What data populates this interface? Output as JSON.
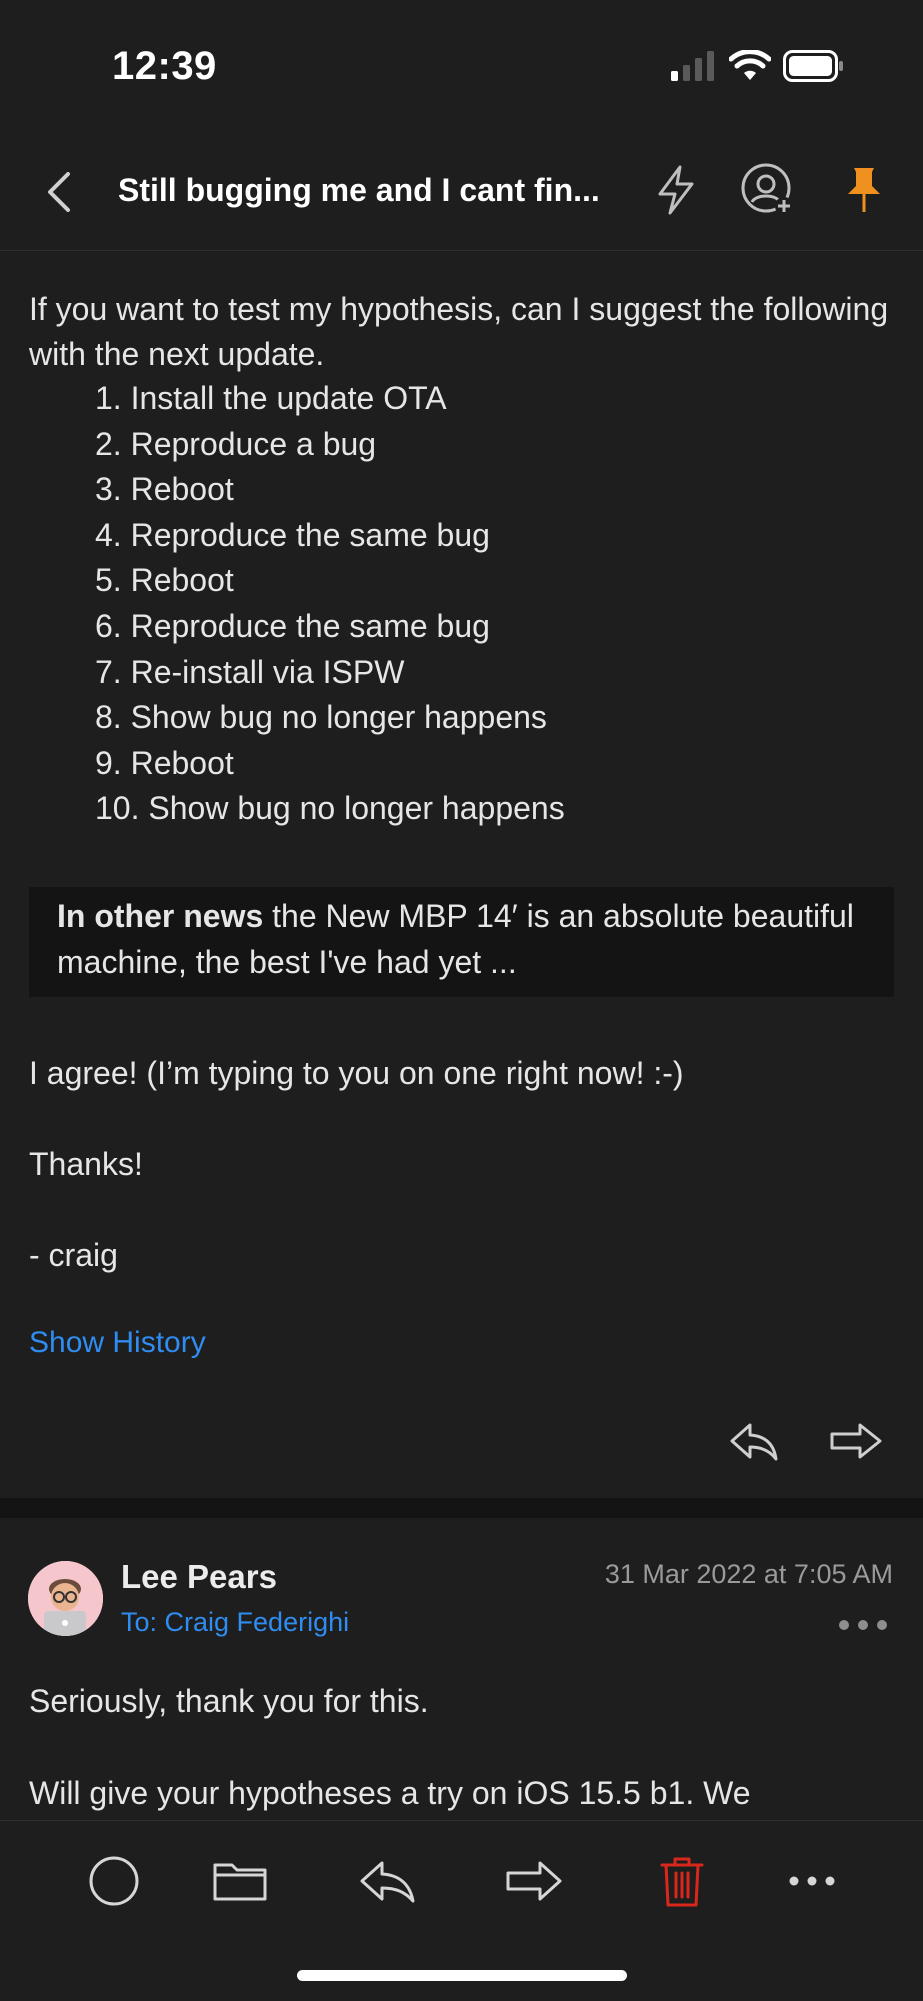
{
  "status": {
    "time": "12:39"
  },
  "header": {
    "subject": "Still bugging me and I cant fin..."
  },
  "message1": {
    "intro": "If you want to test my hypothesis, can I suggest the following with the next update.",
    "steps": [
      "1. Install the update OTA",
      "2. Reproduce a bug",
      "3. Reboot",
      "4. Reproduce the same bug",
      "5. Reboot",
      "6. Reproduce the same bug",
      "7. Re-install via ISPW",
      "8. Show bug no longer happens",
      "9. Reboot",
      "10. Show bug no longer happens"
    ],
    "quote_bold": "In other news",
    "quote_rest": " the New MBP 14′ is an absolute beautiful machine, the best I've had yet ...",
    "reply_line": "I agree!  (I’m typing to you on one right now! :-)",
    "thanks": "Thanks!",
    "signature": "- craig",
    "show_history": "Show History"
  },
  "message2": {
    "sender": "Lee Pears",
    "to": "To: Craig Federighi",
    "date": "31 Mar 2022 at 7:05 AM",
    "line1": "Seriously, thank you for this.",
    "line2": "Will give your hypotheses a try on iOS 15.5 b1. We"
  },
  "colors": {
    "background": "#1e1e1e",
    "link": "#2f8cf0",
    "pin": "#f0901e",
    "delete": "#d9271c"
  },
  "icons": [
    "back-chevron-icon",
    "lightning-icon",
    "add-contact-icon",
    "pin-icon",
    "reply-icon",
    "forward-icon",
    "circle-icon",
    "folder-icon",
    "trash-icon",
    "more-icon"
  ]
}
